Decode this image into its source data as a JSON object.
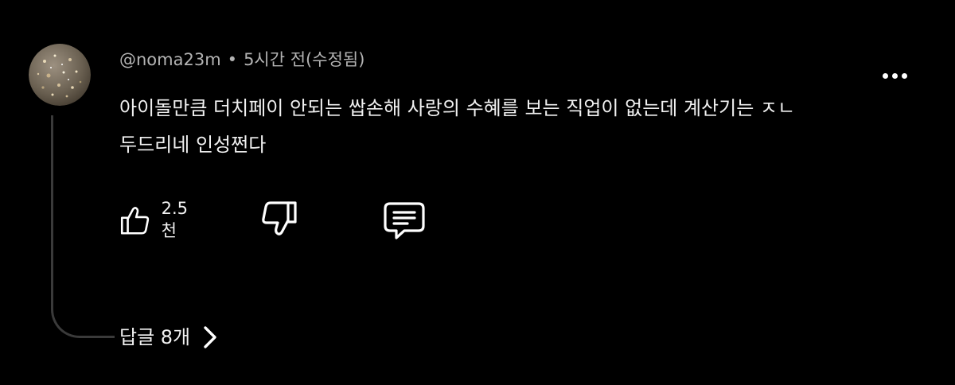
{
  "comment": {
    "author": "@noma23m",
    "separator": "•",
    "time": "5시간 전(수정됨)",
    "text": "아이돌만큼 더치페이 안되는 쌉손해 사랑의 수혜를 보는 직업이 없는데 계산기는 ㅈㄴ\n두드리네 인성쩐다",
    "avatar_icon": "avatar-glitter-image",
    "more_icon": "more-vert-icon"
  },
  "actions": {
    "like_icon": "thumb-up-icon",
    "like_count": "2.5천",
    "dislike_icon": "thumb-down-icon",
    "reply_icon": "comment-icon"
  },
  "replies": {
    "label": "답글 8개",
    "chevron_icon": "chevron-right-icon"
  },
  "colors": {
    "background": "#000000",
    "text": "#f1f1f1",
    "meta_text": "#b3b3b3",
    "thread_line": "#3a3a3a"
  }
}
